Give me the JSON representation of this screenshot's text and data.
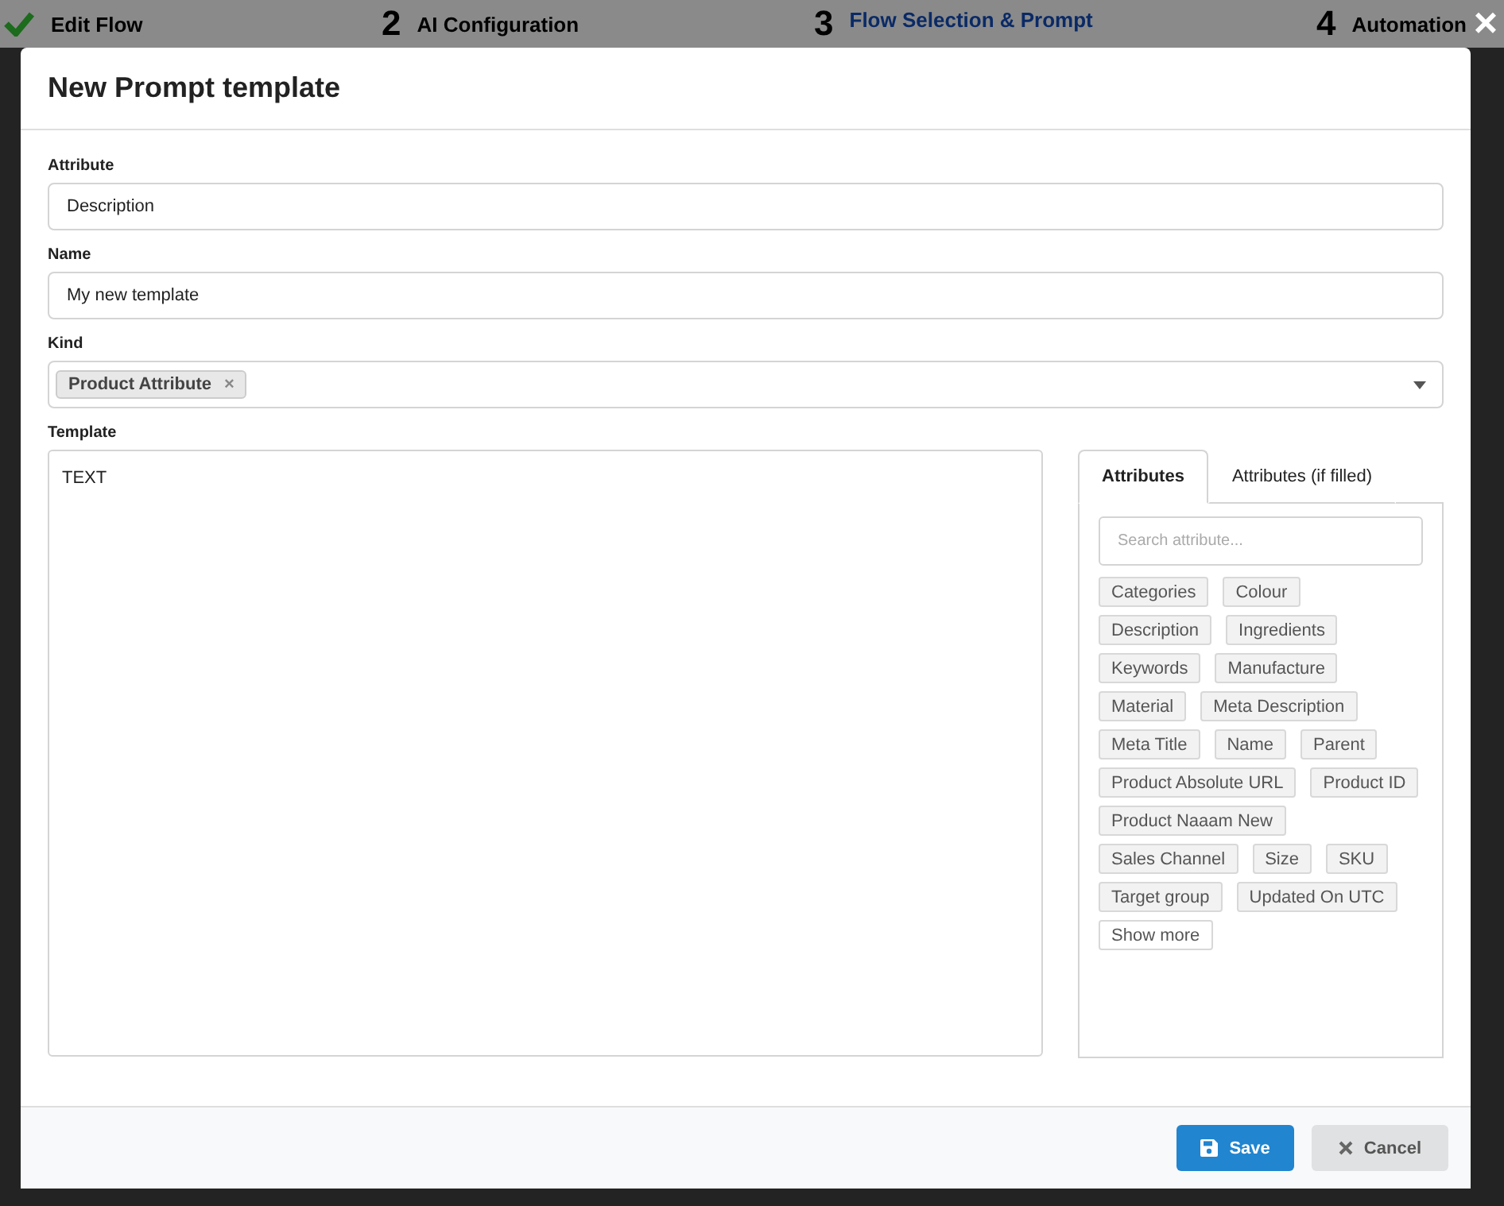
{
  "wizard": {
    "steps": [
      {
        "done": true,
        "label": "Edit Flow",
        "selected": false
      },
      {
        "marker": "2",
        "done": false,
        "label": "AI Configuration",
        "selected": false
      },
      {
        "marker": "3",
        "done": false,
        "label": "Flow Selection & Prompt",
        "selected": true
      },
      {
        "marker": "4",
        "done": false,
        "label": "Automation",
        "selected": false
      }
    ],
    "close": "×"
  },
  "modal": {
    "title": "New Prompt template",
    "fields": [
      {
        "label": "Attribute",
        "value": "Description"
      },
      {
        "label": "Name",
        "value": "My new template"
      }
    ],
    "kind": {
      "label": "Kind",
      "tags": [
        {
          "text": "Product Attribute",
          "remove": "×"
        }
      ]
    },
    "template": {
      "label": "Template",
      "value": "TEXT"
    },
    "attributes_panel": {
      "tabs": [
        {
          "label": "Attributes",
          "selected": true
        },
        {
          "label": "Attributes (if filled)",
          "selected": false
        }
      ],
      "search": {
        "placeholder": "Search attribute..."
      },
      "chips": [
        "Categories",
        "Colour",
        "Description",
        "Ingredients",
        "Keywords",
        "Manufacture",
        "Material",
        "Meta Description",
        "Meta Title",
        "Name",
        "Parent",
        "Product Absolute URL",
        "Product ID",
        "Product Naaam New",
        "Sales Channel",
        "Size",
        "SKU",
        "Target group",
        "Updated On UTC"
      ],
      "show_more": "Show more"
    },
    "buttons": [
      {
        "kind": "primary",
        "label": "Save"
      },
      {
        "kind": "secondary",
        "label": "Cancel"
      }
    ]
  }
}
